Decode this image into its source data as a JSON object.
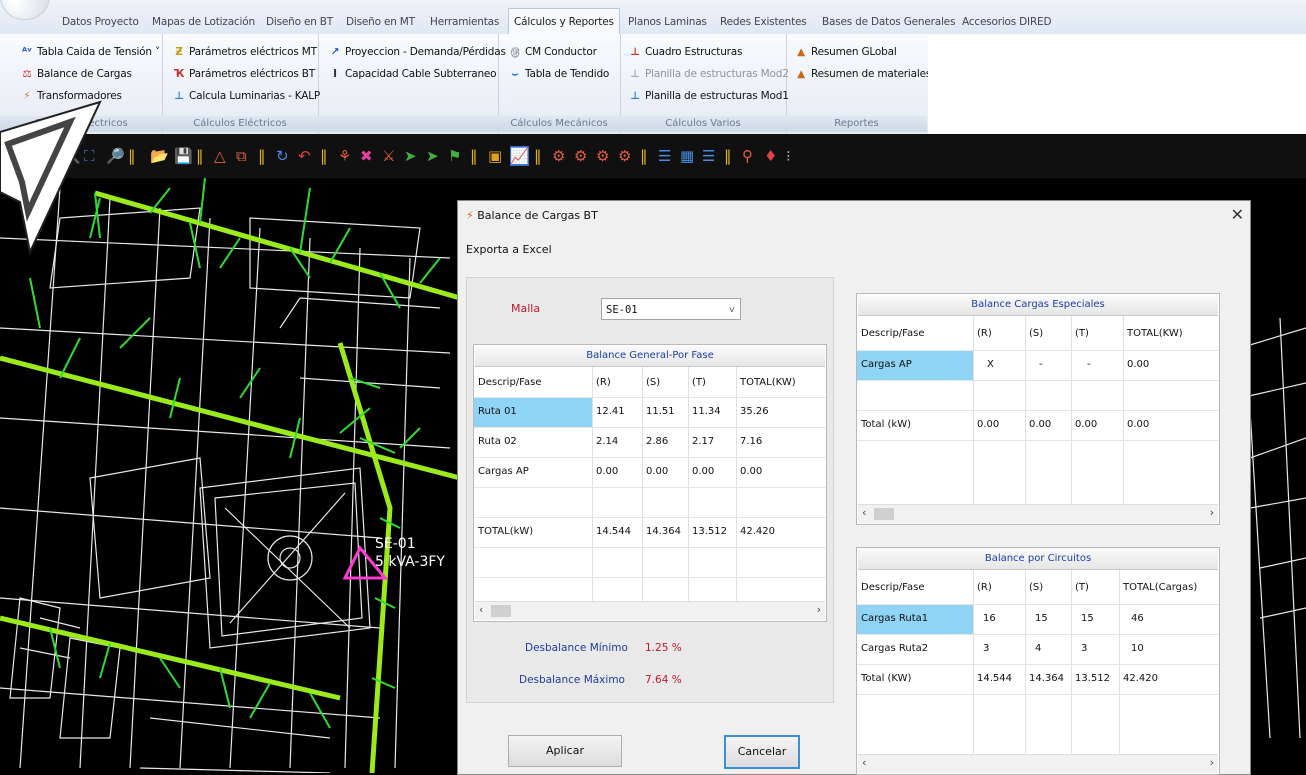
{
  "ribbon_tabs": [
    "Datos Proyecto",
    "Mapas de Lotización",
    "Diseño en BT",
    "Diseño en MT",
    "Herramientas",
    "Cálculos y Reportes",
    "Planos Laminas",
    "Redes Existentes",
    "Bases de Datos Generales",
    "Accesorios DIRED"
  ],
  "active_tab": "Cálculos y Reportes",
  "groups": {
    "electricos": {
      "title": "Cálculos Eléctricos",
      "items": [
        "Tabla Caida de Tensión",
        "Balance de Cargas",
        "Transformadores"
      ]
    },
    "electricos2": {
      "title": "Cálculos Eléctricos",
      "items": [
        "Parámetros eléctricos MT",
        "Parámetros eléctricos BT",
        "Calcula Luminarias - KALP"
      ]
    },
    "proyeccion": {
      "items": [
        "Proyeccion - Demanda/Pérdidas",
        "Capacidad Cable Subterraneo"
      ]
    },
    "mecanicos": {
      "title": "Cálculos Mecánicos",
      "items": [
        "CM Conductor",
        "Tabla de Tendido"
      ]
    },
    "varios": {
      "title": "Cálculos Varios",
      "items": [
        "Cuadro Estructuras",
        "Planilla de estructuras Mod2",
        "Planilla de estructuras Mod1"
      ]
    },
    "reportes": {
      "title": "Reportes",
      "items": [
        "Resumen GLobal",
        "Resumen de materiales"
      ]
    }
  },
  "cad": {
    "label1": "SE-01",
    "label2": "5 kVA-3FY"
  },
  "colors": {
    "conductor": "#9bea1c",
    "accent": "#2fdc2f",
    "marker": "#ff3ad2",
    "selected": "#8fd3f5",
    "header_text": "#1a3fa6",
    "red_text": "#c0182a",
    "blue_text": "#1f3c9e"
  },
  "dialog": {
    "title": "Balance de Cargas  BT",
    "menu": "Exporta a Excel",
    "malla_label": "Malla",
    "malla_value": "SE-01",
    "general": {
      "title": "Balance General-Por Fase",
      "columns": [
        "Descrip/Fase",
        "(R)",
        "(S)",
        "(T)",
        "TOTAL(KW)"
      ],
      "rows": [
        [
          "Ruta 01",
          "12.41",
          "11.51",
          "11.34",
          "35.26"
        ],
        [
          "Ruta 02",
          "2.14",
          "2.86",
          "2.17",
          "7.16"
        ],
        [
          "Cargas AP",
          "0.00",
          "0.00",
          "0.00",
          "0.00"
        ],
        [
          "",
          "",
          "",
          "",
          ""
        ],
        [
          "TOTAL(kW)",
          "14.544",
          "14.364",
          "13.512",
          "42.420"
        ]
      ]
    },
    "desbalance_min_label": "Desbalance Mínimo",
    "desbalance_min_value": "1.25 %",
    "desbalance_max_label": "Desbalance Máximo",
    "desbalance_max_value": "7.64 %",
    "especiales": {
      "title": "Balance Cargas Especiales",
      "columns": [
        "Descrip/Fase",
        "(R)",
        "(S)",
        "(T)",
        "TOTAL(KW)"
      ],
      "rows": [
        [
          "Cargas AP",
          "X",
          "-",
          "-",
          "0.00"
        ],
        [
          "",
          "",
          "",
          "",
          ""
        ],
        [
          "Total (kW)",
          "0.00",
          "0.00",
          "0.00",
          "0.00"
        ]
      ]
    },
    "circuitos": {
      "title": "Balance por Circuitos",
      "columns": [
        "Descrip/Fase",
        "(R)",
        "(S)",
        "(T)",
        "TOTAL(Cargas)"
      ],
      "rows": [
        [
          "Cargas Ruta1",
          "16",
          "15",
          "15",
          "46"
        ],
        [
          "Cargas Ruta2",
          "3",
          "4",
          "3",
          "10"
        ],
        [
          "Total (KW)",
          "14.544",
          "14.364",
          "13.512",
          "42.420"
        ]
      ]
    },
    "apply_label": "Aplicar",
    "cancel_label": "Cancelar"
  }
}
